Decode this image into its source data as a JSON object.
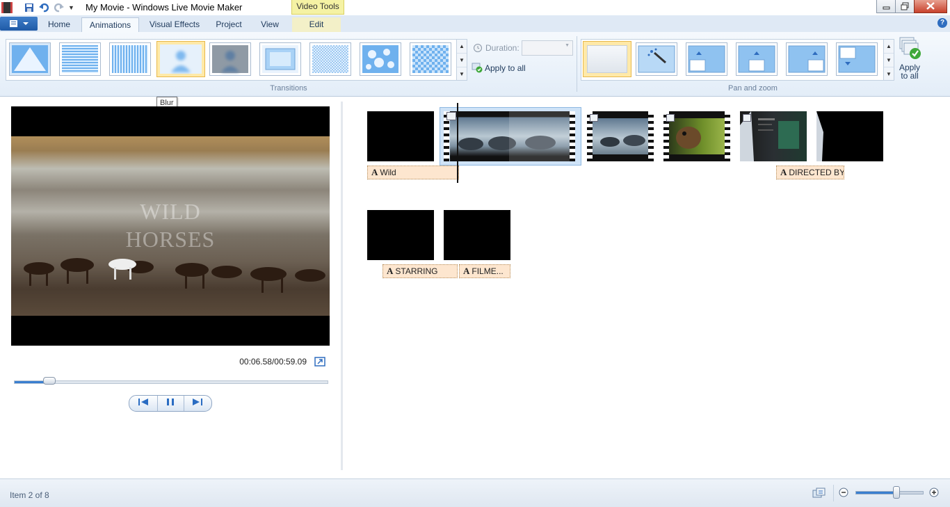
{
  "window": {
    "title": "My Movie - Windows Live Movie Maker",
    "context_tab": "Video Tools"
  },
  "tabs": [
    {
      "label": "Home"
    },
    {
      "label": "Animations"
    },
    {
      "label": "Visual Effects"
    },
    {
      "label": "Project"
    },
    {
      "label": "View"
    },
    {
      "label": "Edit"
    }
  ],
  "ribbon": {
    "transitions_group_label": "Transitions",
    "duration_label": "Duration:",
    "duration_value": "",
    "apply_to_all_label": "Apply to all",
    "panzoom_group_label": "Pan and zoom",
    "panzoom_apply_label_1": "Apply",
    "panzoom_apply_label_2": "to all",
    "tooltip": "Blur",
    "transitions": [
      "Diagonal",
      "Bars horizontal",
      "Bars vertical",
      "Blur",
      "Fade through black",
      "Zoom",
      "Pixelate",
      "Dissolve",
      "Checkerboard"
    ],
    "selected_transition": "Blur"
  },
  "preview": {
    "overlay_line1": "WILD",
    "overlay_line2": "HORSES",
    "time": "00:06.58/00:59.09",
    "progress": 0.11
  },
  "storyboard": {
    "captions": {
      "wild": "Wild",
      "directed_by": "DIRECTED BY",
      "starring": "STARRING",
      "filmed": "FILME..."
    }
  },
  "status": {
    "item": "Item 2 of 8",
    "zoom": 0.6
  },
  "colors": {
    "accent": "#3a7fd0",
    "caption_bg": "#fde6cf",
    "context_tab": "#f5f2a4",
    "selection": "#ffe9a8"
  }
}
